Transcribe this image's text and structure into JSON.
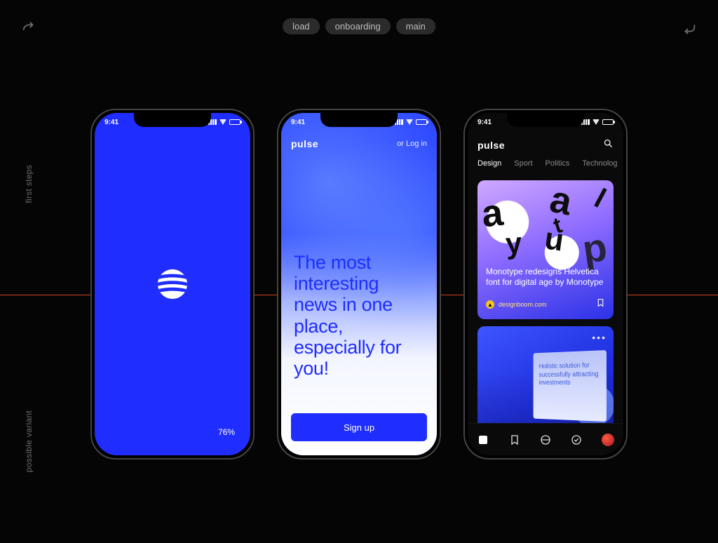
{
  "tags": {
    "load": "load",
    "onboarding": "onboarding",
    "main": "main"
  },
  "side_labels": {
    "upper": "first steps",
    "lower": "possible variant"
  },
  "status_time": "9:41",
  "colors": {
    "brand_blue": "#1f2dff",
    "accent_red": "#e84a22"
  },
  "load_screen": {
    "progress": "76%"
  },
  "onboarding_screen": {
    "brand": "pulse",
    "login_text": "or Log in",
    "headline": "The most interesting news in one place, especially for you!",
    "signup_label": "Sign up"
  },
  "main_screen": {
    "brand": "pulse",
    "tabs": [
      "Design",
      "Sport",
      "Politics",
      "Technolog"
    ],
    "active_tab_index": 0,
    "card1": {
      "title": "Monotype redesigns Helvetica font for digital age by Monotype",
      "source": "designboom.com"
    },
    "card2": {
      "panel_text": "Holistic solution for successfully attracting investments",
      "more": "•••"
    }
  }
}
